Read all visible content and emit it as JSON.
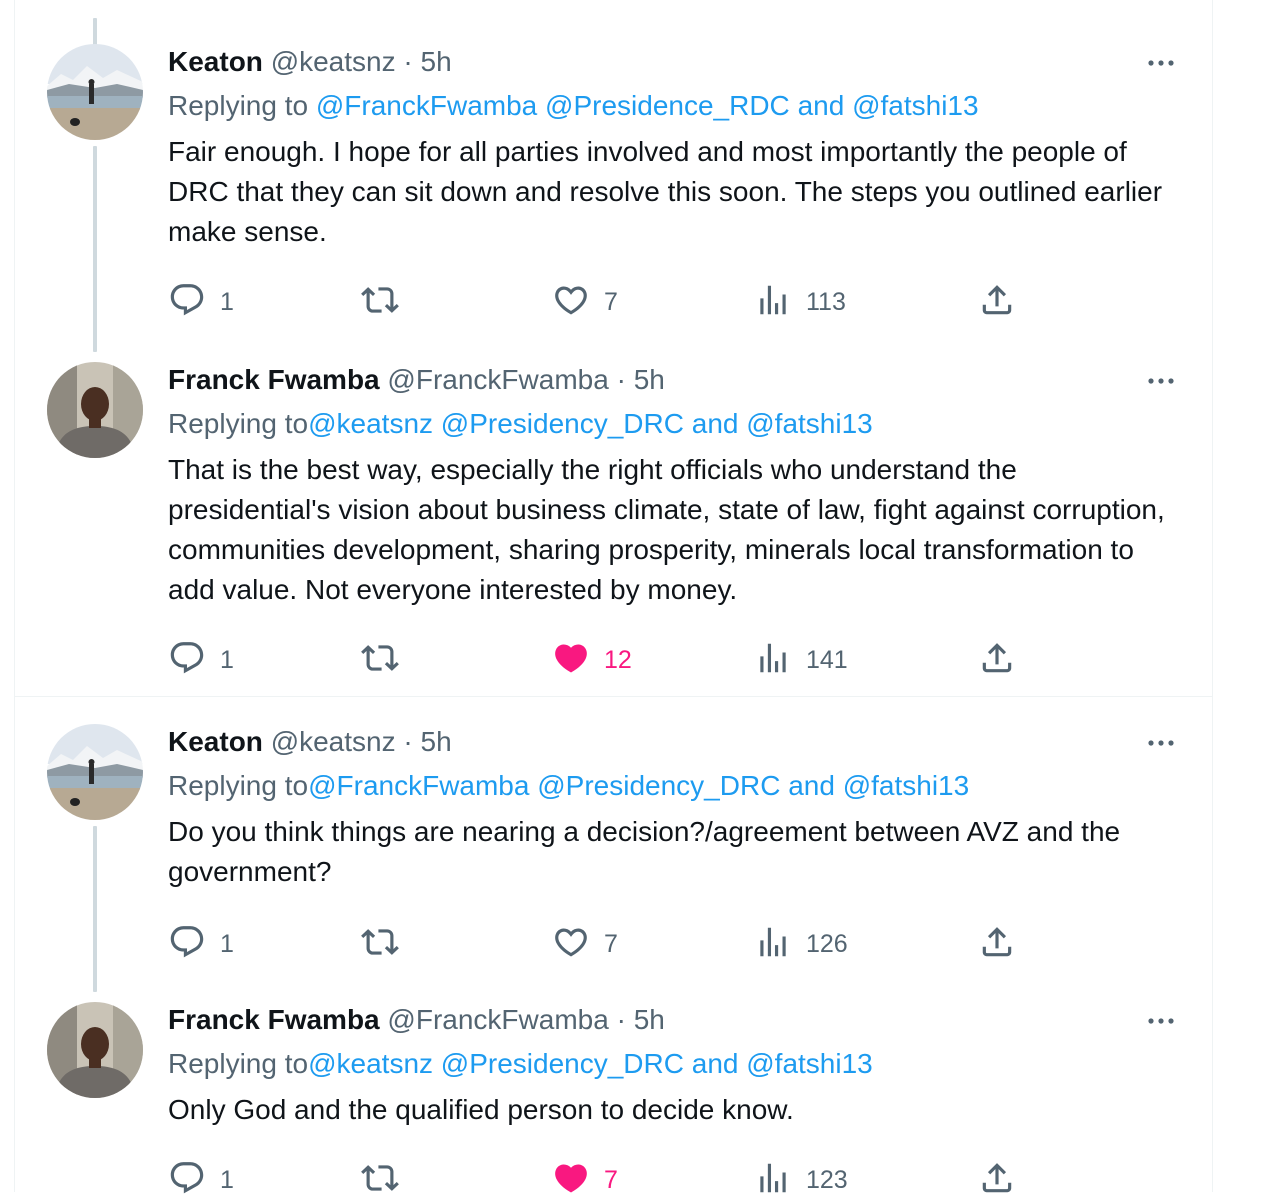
{
  "tweets": [
    {
      "name": "Keaton",
      "handle": "@keatsnz",
      "time": "5h",
      "replying_prefix": "Replying to ",
      "mentions": [
        "@FranckFwamba",
        "@Presidence_RDC"
      ],
      "and_text": "and",
      "last_mention": "@fatshi13",
      "text": "Fair enough. I hope for all parties involved and most importantly the people of DRC that they can sit down and resolve this soon. The steps you outlined earlier make sense.",
      "replies": "1",
      "likes": "7",
      "liked": false,
      "views": "113",
      "avatar": "landscape"
    },
    {
      "name": "Franck Fwamba",
      "handle": "@FranckFwamba",
      "time": "5h",
      "replying_prefix": "Replying to",
      "mentions": [
        "@keatsnz",
        "@Presidency_DRC"
      ],
      "and_text": "and",
      "last_mention": "@fatshi13",
      "text": "That is the best way, especially the right officials who understand the presidential's vision about business climate, state of law, fight against corruption, communities development, sharing prosperity, minerals local transformation to add value. Not everyone interested by money.",
      "replies": "1",
      "likes": "12",
      "liked": true,
      "views": "141",
      "avatar": "person"
    },
    {
      "name": "Keaton",
      "handle": "@keatsnz",
      "time": "5h",
      "replying_prefix": "Replying to",
      "mentions": [
        "@FranckFwamba",
        "@Presidency_DRC"
      ],
      "and_text": "and",
      "last_mention": "@fatshi13",
      "text": "Do you think things are nearing a decision?/agreement between AVZ and the government?",
      "replies": "1",
      "likes": "7",
      "liked": false,
      "views": "126",
      "avatar": "landscape"
    },
    {
      "name": "Franck Fwamba",
      "handle": "@FranckFwamba",
      "time": "5h",
      "replying_prefix": "Replying to",
      "mentions": [
        "@keatsnz",
        "@Presidency_DRC"
      ],
      "and_text": "and",
      "last_mention": "@fatshi13",
      "text": "Only God and the qualified person to decide know.",
      "replies": "1",
      "likes": "7",
      "liked": true,
      "views": "123",
      "avatar": "person"
    }
  ],
  "separator": " · ",
  "icons": {
    "reply": "reply-icon",
    "retweet": "retweet-icon",
    "like": "heart-icon",
    "views": "views-icon",
    "share": "share-icon",
    "more": "more-icon"
  },
  "colors": {
    "link": "#1d9bf0",
    "liked": "#f91880",
    "muted": "#536471",
    "thread_line": "#cfd9de"
  }
}
